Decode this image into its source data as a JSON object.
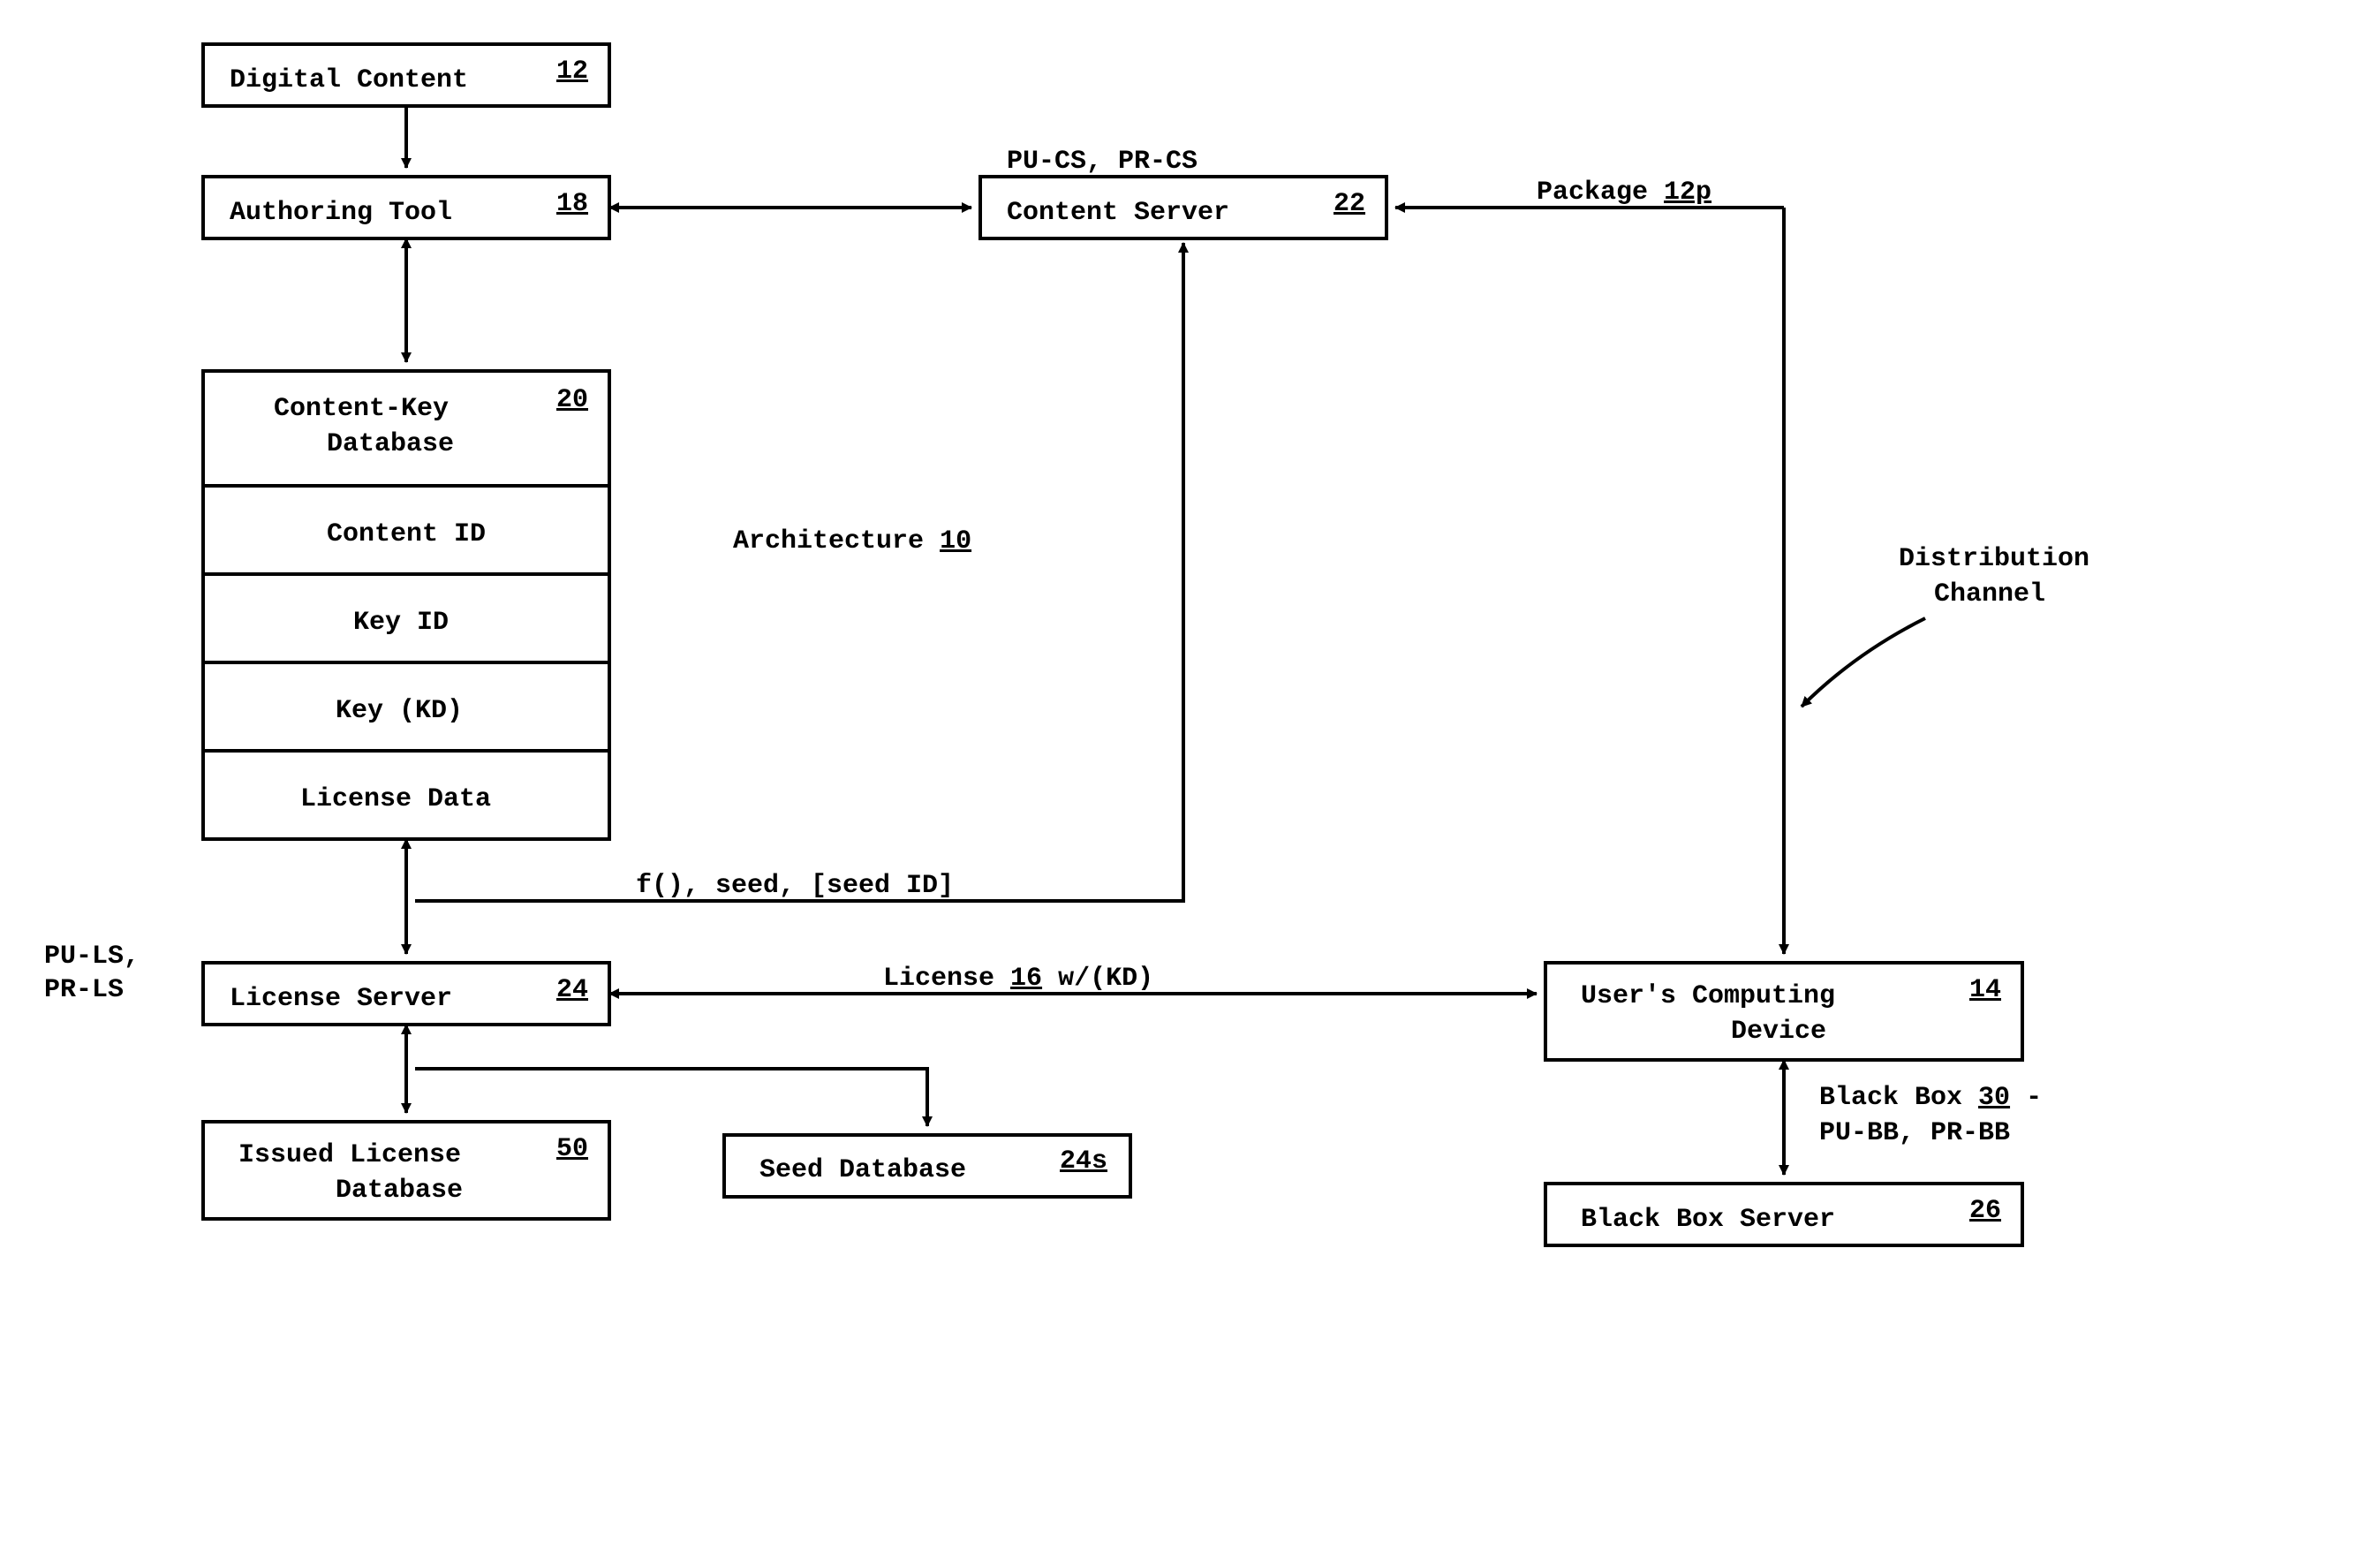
{
  "architecture": {
    "label": "Architecture",
    "ref": "10"
  },
  "boxes": {
    "digital_content": {
      "label": "Digital Content",
      "ref": "12"
    },
    "authoring_tool": {
      "label": "Authoring Tool",
      "ref": "18"
    },
    "content_key_db": {
      "label": "Content-Key",
      "label2": "Database",
      "ref": "20",
      "rows": [
        "Content ID",
        "Key ID",
        "Key (KD)",
        "License Data"
      ]
    },
    "license_server": {
      "label": "License Server",
      "ref": "24"
    },
    "issued_license_db": {
      "label": "Issued License",
      "label2": "Database",
      "ref": "50"
    },
    "seed_db": {
      "label": "Seed Database",
      "ref": "24s"
    },
    "content_server": {
      "label": "Content Server",
      "ref": "22"
    },
    "user_device": {
      "label": "User's Computing",
      "label2": "Device",
      "ref": "14"
    },
    "black_box_server": {
      "label": "Black Box Server",
      "ref": "26"
    }
  },
  "labels": {
    "pucs": "PU-CS, PR-CS",
    "puls1": "PU-LS,",
    "puls2": "PR-LS",
    "package": "Package",
    "package_ref": "12p",
    "dist1": "Distribution",
    "dist2": "Channel",
    "fseed": "f(), seed, [seed ID]",
    "license": "License",
    "license_ref": "16",
    "license_tail": " w/(KD)",
    "blackbox": "Black Box ",
    "blackbox_ref": "30",
    "blackbox_tail": " -",
    "pubb": "PU-BB, PR-BB"
  }
}
